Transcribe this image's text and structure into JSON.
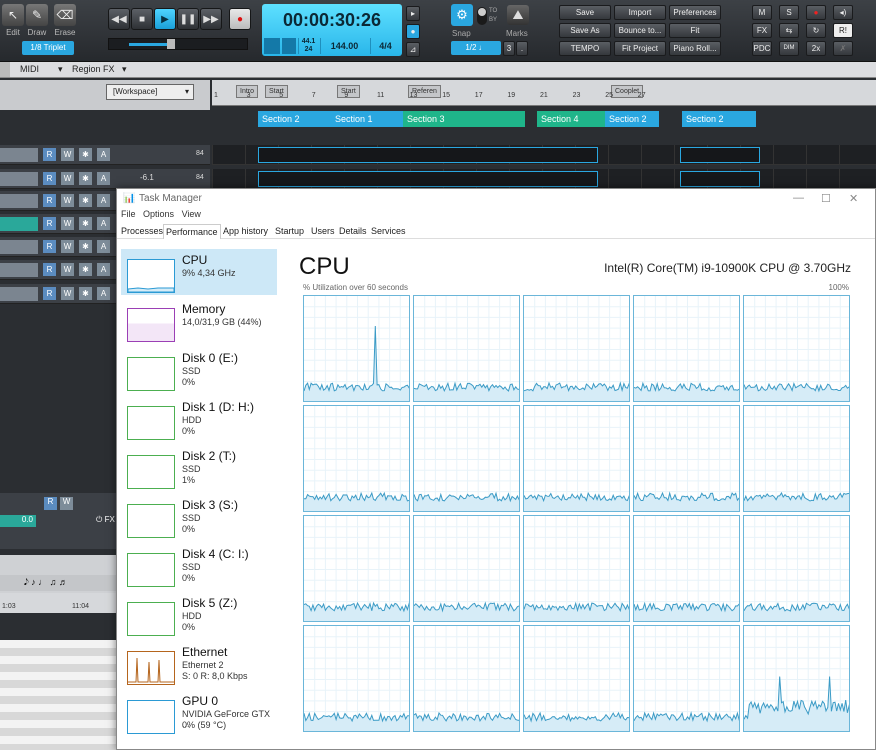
{
  "daw": {
    "tools": [
      {
        "label": "Edit",
        "icon": "edit-icon"
      },
      {
        "label": "Draw",
        "icon": "pencil-icon"
      },
      {
        "label": "Erase",
        "icon": "eraser-icon"
      }
    ],
    "snap_preset": "1/8 Triplet",
    "transport": {
      "time": "00:00:30:26",
      "sample_rate": "44.1",
      "bit_depth": "24",
      "tempo": "144.00",
      "meter": "4/4"
    },
    "snap": {
      "label": "Snap",
      "value": "1/2",
      "marks_label": "Marks",
      "marks_value": "3",
      "to_label": "TO",
      "by_label": "BY"
    },
    "buttons": [
      "Save",
      "Import",
      "Preferences",
      "Save As",
      "Bounce to...",
      "Fit",
      "TEMPO",
      "Fit Project",
      "Piano Roll..."
    ],
    "right_buttons": [
      "M",
      "S",
      "FX",
      "PDC",
      "DIM",
      "2x",
      "R!"
    ],
    "menubar": [
      "MIDI",
      "Region FX"
    ],
    "workspace": "[Workspace]",
    "arranger_markers": [
      "Intro",
      "Start",
      "Start",
      "Referen",
      "Cooplet"
    ],
    "bar_numbers": [
      "1",
      "3",
      "5",
      "7",
      "9",
      "11",
      "13",
      "15",
      "17",
      "19",
      "21",
      "23",
      "25",
      "27"
    ],
    "sections": [
      {
        "label": "Section 2",
        "color": "#2aa7e0"
      },
      {
        "label": "Section 1",
        "color": "#2aa7e0"
      },
      {
        "label": "Section 3",
        "color": "#1fb58a"
      },
      {
        "label": "Section 4",
        "color": "#1fb58a"
      },
      {
        "label": "Section 2",
        "color": "#2aa7e0"
      },
      {
        "label": "Section 2",
        "color": "#2aa7e0"
      }
    ],
    "track_values": [
      "84",
      "-6.1",
      "84"
    ],
    "bottom_time_labels": [
      "1:03",
      "11:04"
    ],
    "mini_value": "0.0",
    "fx_label": "FX"
  },
  "taskmanager": {
    "title": "Task Manager",
    "menu": [
      "File",
      "Options",
      "View"
    ],
    "tabs": [
      "Processes",
      "Performance",
      "App history",
      "Startup",
      "Users",
      "Details",
      "Services"
    ],
    "active_tab": "Performance",
    "resources": [
      {
        "name": "CPU",
        "sub1": "9%  4,34 GHz",
        "sub2": "",
        "color": "#2b9ad4"
      },
      {
        "name": "Memory",
        "sub1": "14,0/31,9 GB (44%)",
        "sub2": "",
        "color": "#9b3fb5"
      },
      {
        "name": "Disk 0 (E:)",
        "sub1": "SSD",
        "sub2": "0%",
        "color": "#4caf50"
      },
      {
        "name": "Disk 1 (D: H:)",
        "sub1": "HDD",
        "sub2": "0%",
        "color": "#4caf50"
      },
      {
        "name": "Disk 2 (T:)",
        "sub1": "SSD",
        "sub2": "1%",
        "color": "#4caf50"
      },
      {
        "name": "Disk 3 (S:)",
        "sub1": "SSD",
        "sub2": "0%",
        "color": "#4caf50"
      },
      {
        "name": "Disk 4 (C: I:)",
        "sub1": "SSD",
        "sub2": "0%",
        "color": "#4caf50"
      },
      {
        "name": "Disk 5 (Z:)",
        "sub1": "HDD",
        "sub2": "0%",
        "color": "#4caf50"
      },
      {
        "name": "Ethernet",
        "sub1": "Ethernet 2",
        "sub2": "S: 0  R: 8,0 Kbps",
        "color": "#b5651d"
      },
      {
        "name": "GPU 0",
        "sub1": "NVIDIA GeForce GTX ...",
        "sub2": "0%  (59 °C)",
        "color": "#2b9ad4"
      }
    ],
    "main_title": "CPU",
    "cpu_model": "Intel(R) Core(TM) i9-10900K CPU @ 3.70GHz",
    "util_label": "% Utilization over 60 seconds",
    "util_max": "100%",
    "core_graph_count": 20
  }
}
